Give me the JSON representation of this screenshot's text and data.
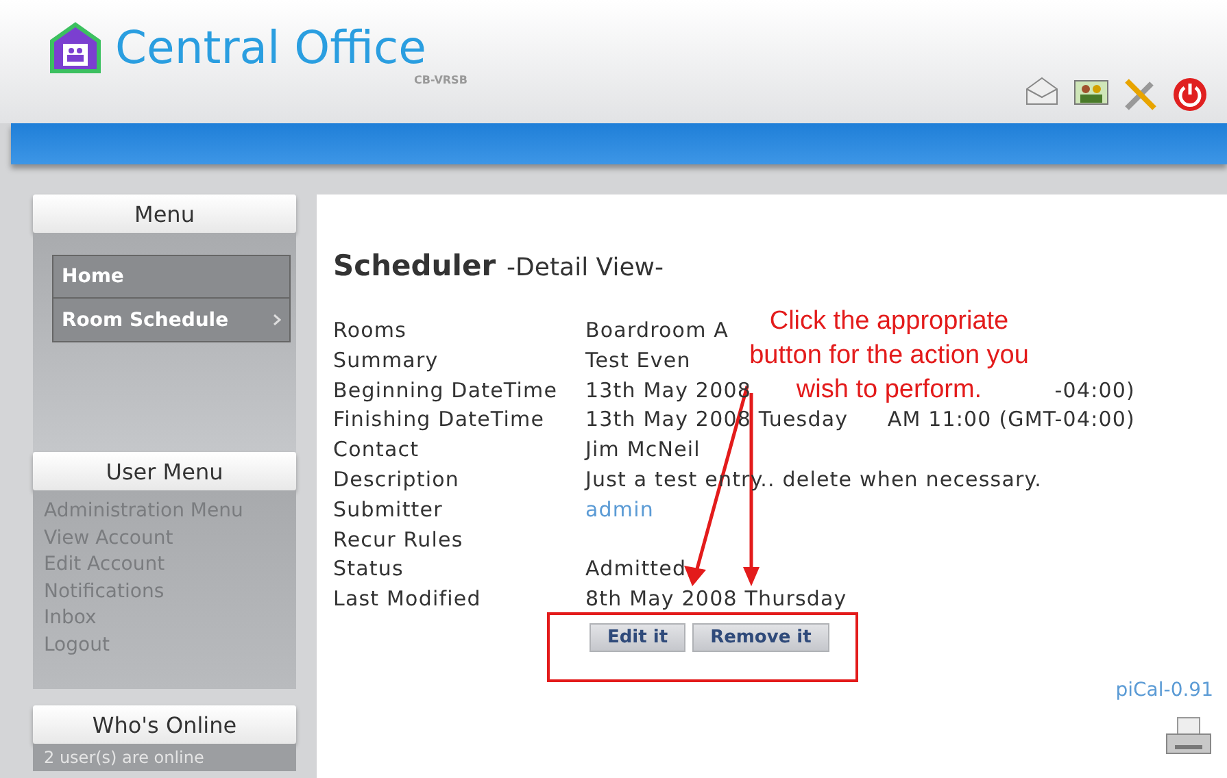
{
  "header": {
    "title": "Central Office",
    "subtitle": "CB-VRSB"
  },
  "sidebar": {
    "menu": {
      "title": "Menu",
      "items": [
        {
          "label": "Home",
          "has_submenu": false
        },
        {
          "label": "Room Schedule",
          "has_submenu": true
        }
      ]
    },
    "user_menu": {
      "title": "User Menu",
      "items": [
        "Administration Menu",
        "View Account",
        "Edit Account",
        "Notifications",
        "Inbox",
        "Logout"
      ]
    },
    "whos_online": {
      "title": "Who's Online",
      "text": "2 user(s) are online"
    }
  },
  "content": {
    "title": "Scheduler",
    "subtitle": "-Detail View-",
    "fields": [
      {
        "label": "Rooms",
        "kind": "text",
        "value": [
          "Boardroom A"
        ]
      },
      {
        "label": "Summary",
        "kind": "text",
        "value": [
          "Test Even"
        ]
      },
      {
        "label": "Beginning DateTime",
        "kind": "text",
        "value": [
          "13th May 2008",
          "-04:00)"
        ]
      },
      {
        "label": "Finishing DateTime",
        "kind": "text",
        "value": [
          "13th May 2008 Tuesday",
          "AM 11:00 (GMT-04:00)"
        ]
      },
      {
        "label": "Contact",
        "kind": "text",
        "value": [
          "Jim McNeil"
        ]
      },
      {
        "label": "Description",
        "kind": "text",
        "value": [
          "Just a test entry.. delete when necessary."
        ]
      },
      {
        "label": "Submitter",
        "kind": "link",
        "value": [
          "admin"
        ]
      },
      {
        "label": "Recur Rules"
      },
      {
        "label": "Status",
        "kind": "text",
        "value": [
          "Admitted"
        ]
      },
      {
        "label": "Last Modified",
        "kind": "text",
        "value": [
          "8th May 2008 Thursday"
        ]
      }
    ],
    "buttons": [
      "Edit it",
      "Remove it"
    ],
    "footer": "piCal-0.91"
  },
  "annotation": {
    "lines": [
      "Click the appropriate",
      "button for the action you",
      "wish to perform."
    ]
  }
}
